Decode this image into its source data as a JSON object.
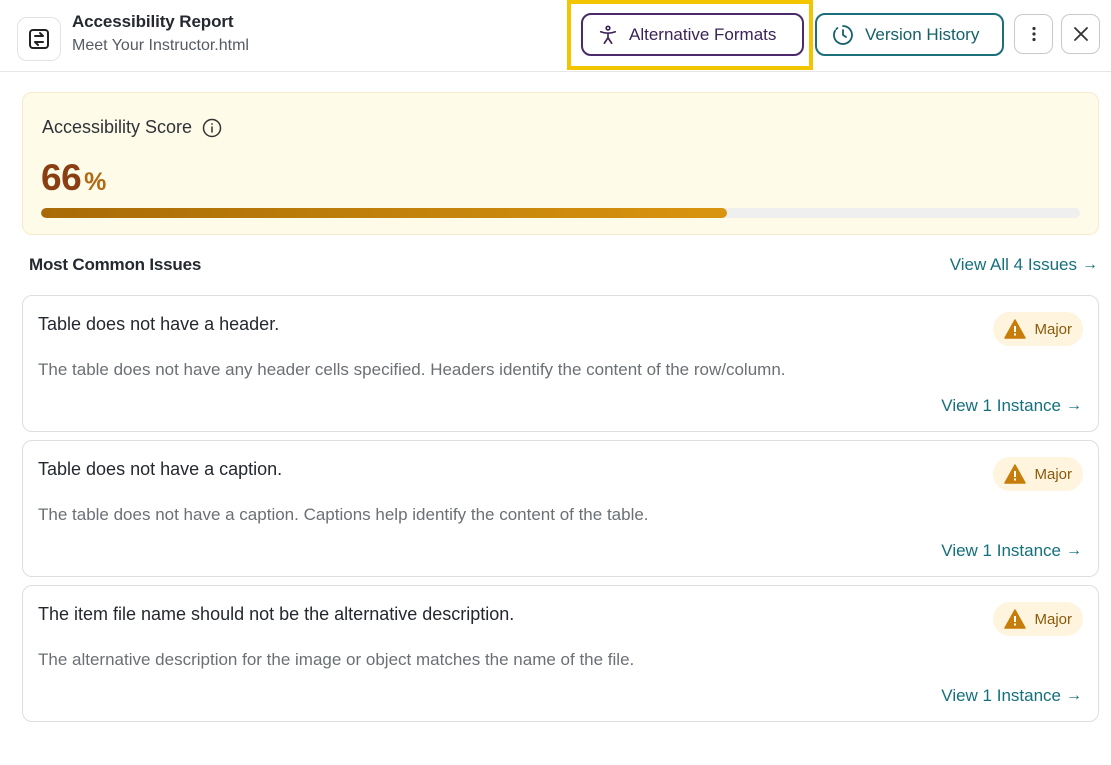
{
  "header": {
    "title": "Accessibility Report",
    "file_name": "Meet Your Instructor.html",
    "app_icon": "swap-arrows-icon",
    "alt_formats_label": "Alternative Formats",
    "alt_formats_icon": "accessibility-person-icon",
    "version_history_label": "Version History",
    "version_history_icon": "history-clock-icon",
    "more_icon": "more-vertical-icon",
    "close_icon": "close-icon"
  },
  "score": {
    "label": "Accessibility Score",
    "info_icon": "info-icon",
    "value": "66",
    "unit": "%",
    "progress_percent": 66
  },
  "issues_section": {
    "title": "Most Common Issues",
    "view_all_label": "View All 4 Issues",
    "arrow": "→"
  },
  "issues": [
    {
      "title": "Table does not have a header.",
      "description": "The table does not have any header cells specified. Headers identify the content of the row/column.",
      "severity": "Major",
      "link_label": "View 1 Instance",
      "arrow": "→"
    },
    {
      "title": "Table does not have a caption.",
      "description": "The table does not have a caption. Captions help identify the content of the table.",
      "severity": "Major",
      "link_label": "View 1 Instance",
      "arrow": "→"
    },
    {
      "title": "The item file name should not be the alternative description.",
      "description": "The alternative description for the image or object matches the name of the file.",
      "severity": "Major",
      "link_label": "View 1 Instance",
      "arrow": "→"
    }
  ],
  "colors": {
    "score_value": "#8a3f12",
    "progress_fill": "#c98a0b",
    "link": "#14707c",
    "alt_formats_border": "#4b2a6b",
    "version_history_border": "#1a6f7a",
    "highlight": "#f2c500",
    "badge_bg": "#fff4dd",
    "warning": "#c77d0a"
  }
}
